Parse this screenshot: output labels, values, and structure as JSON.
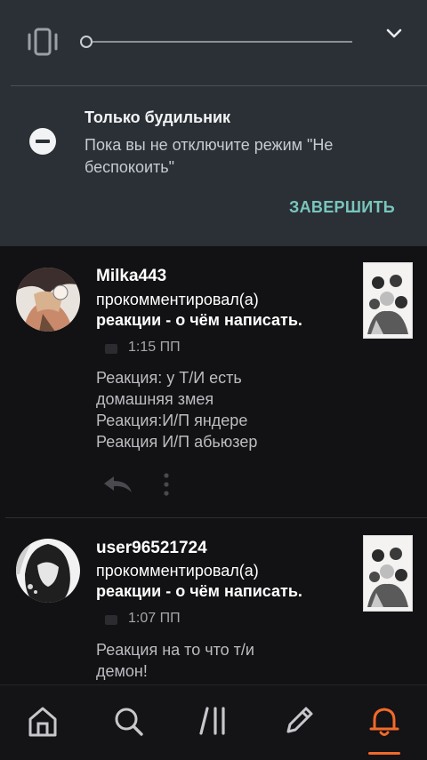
{
  "quick_settings": {
    "sound_mode_icon": "vibrate-icon",
    "expand_icon": "chevron-down-icon",
    "volume_level": 0
  },
  "dnd": {
    "icon": "do-not-disturb-icon",
    "title": "Только будильник",
    "description": "Пока вы не отключите режим \"Не беспокоить\"",
    "end_button": "ЗАВЕРШИТЬ",
    "accent_color": "#79c6bd"
  },
  "notifications": [
    {
      "username": "Milka443",
      "action": "прокомментировал(а)",
      "story": "реакции - о чём написать.",
      "time": "1:15 ПП",
      "comment_lines": [
        "Реакция: у Т/И есть",
        "домашняя змея",
        "Реакция:И/П яндере",
        "Реакция И/П абьюзер"
      ]
    },
    {
      "username": "user96521724",
      "action": "прокомментировал(а)",
      "story": "реакции - о чём написать.",
      "time": "1:07 ПП",
      "comment_lines": [
        "Реакция на то что т/и",
        "демон!"
      ]
    }
  ],
  "bottom_nav": {
    "items": [
      "home-icon",
      "search-icon",
      "library-icon",
      "write-icon",
      "notifications-icon"
    ],
    "active": "notifications-icon",
    "active_color": "#f26a2a"
  }
}
